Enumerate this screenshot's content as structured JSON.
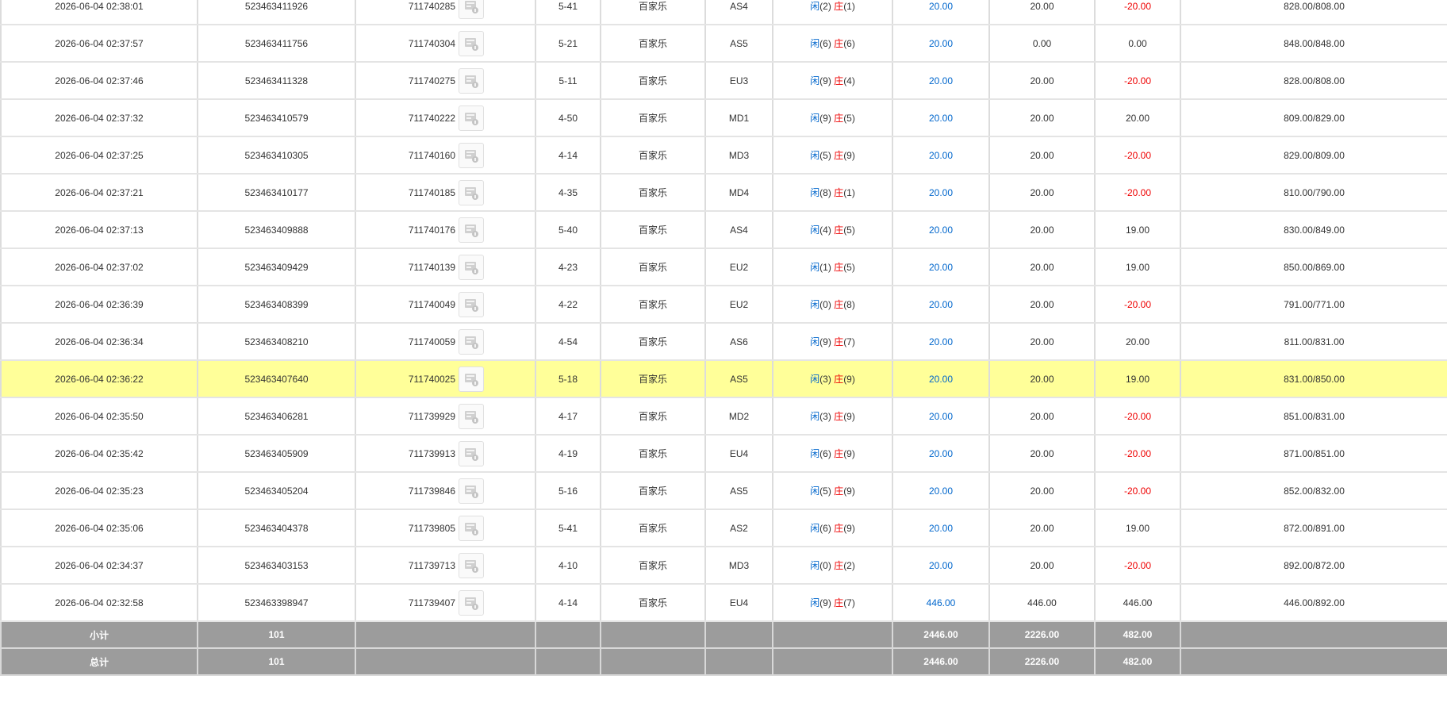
{
  "table": {
    "rows": [
      {
        "time": "2026-06-04 02:38:01",
        "order_id": "523463411926",
        "round": "711740285",
        "shoe": "5-41",
        "game": "百家乐",
        "table": "AS4",
        "p_label": "闲",
        "p_val": "(2)",
        "b_label": "庄",
        "b_val": "(1)",
        "bet": "20.00",
        "valid": "20.00",
        "result": "-20.00",
        "result_color": "red",
        "balance": "828.00/808.00"
      },
      {
        "time": "2026-06-04 02:37:57",
        "order_id": "523463411756",
        "round": "711740304",
        "shoe": "5-21",
        "game": "百家乐",
        "table": "AS5",
        "p_label": "闲",
        "p_val": "(6)",
        "b_label": "庄",
        "b_val": "(6)",
        "bet": "20.00",
        "valid": "0.00",
        "result": "0.00",
        "result_color": "dark",
        "balance": "848.00/848.00"
      },
      {
        "time": "2026-06-04 02:37:46",
        "order_id": "523463411328",
        "round": "711740275",
        "shoe": "5-11",
        "game": "百家乐",
        "table": "EU3",
        "p_label": "闲",
        "p_val": "(9)",
        "b_label": "庄",
        "b_val": "(4)",
        "bet": "20.00",
        "valid": "20.00",
        "result": "-20.00",
        "result_color": "red",
        "balance": "828.00/808.00"
      },
      {
        "time": "2026-06-04 02:37:32",
        "order_id": "523463410579",
        "round": "711740222",
        "shoe": "4-50",
        "game": "百家乐",
        "table": "MD1",
        "p_label": "闲",
        "p_val": "(9)",
        "b_label": "庄",
        "b_val": "(5)",
        "bet": "20.00",
        "valid": "20.00",
        "result": "20.00",
        "result_color": "dark",
        "balance": "809.00/829.00"
      },
      {
        "time": "2026-06-04 02:37:25",
        "order_id": "523463410305",
        "round": "711740160",
        "shoe": "4-14",
        "game": "百家乐",
        "table": "MD3",
        "p_label": "闲",
        "p_val": "(5)",
        "b_label": "庄",
        "b_val": "(9)",
        "bet": "20.00",
        "valid": "20.00",
        "result": "-20.00",
        "result_color": "red",
        "balance": "829.00/809.00"
      },
      {
        "time": "2026-06-04 02:37:21",
        "order_id": "523463410177",
        "round": "711740185",
        "shoe": "4-35",
        "game": "百家乐",
        "table": "MD4",
        "p_label": "闲",
        "p_val": "(8)",
        "b_label": "庄",
        "b_val": "(1)",
        "bet": "20.00",
        "valid": "20.00",
        "result": "-20.00",
        "result_color": "red",
        "balance": "810.00/790.00"
      },
      {
        "time": "2026-06-04 02:37:13",
        "order_id": "523463409888",
        "round": "711740176",
        "shoe": "5-40",
        "game": "百家乐",
        "table": "AS4",
        "p_label": "闲",
        "p_val": "(4)",
        "b_label": "庄",
        "b_val": "(5)",
        "bet": "20.00",
        "valid": "20.00",
        "result": "19.00",
        "result_color": "dark",
        "balance": "830.00/849.00"
      },
      {
        "time": "2026-06-04 02:37:02",
        "order_id": "523463409429",
        "round": "711740139",
        "shoe": "4-23",
        "game": "百家乐",
        "table": "EU2",
        "p_label": "闲",
        "p_val": "(1)",
        "b_label": "庄",
        "b_val": "(5)",
        "bet": "20.00",
        "valid": "20.00",
        "result": "19.00",
        "result_color": "dark",
        "balance": "850.00/869.00"
      },
      {
        "time": "2026-06-04 02:36:39",
        "order_id": "523463408399",
        "round": "711740049",
        "shoe": "4-22",
        "game": "百家乐",
        "table": "EU2",
        "p_label": "闲",
        "p_val": "(0)",
        "b_label": "庄",
        "b_val": "(8)",
        "bet": "20.00",
        "valid": "20.00",
        "result": "-20.00",
        "result_color": "red",
        "balance": "791.00/771.00"
      },
      {
        "time": "2026-06-04 02:36:34",
        "order_id": "523463408210",
        "round": "711740059",
        "shoe": "4-54",
        "game": "百家乐",
        "table": "AS6",
        "p_label": "闲",
        "p_val": "(9)",
        "b_label": "庄",
        "b_val": "(7)",
        "bet": "20.00",
        "valid": "20.00",
        "result": "20.00",
        "result_color": "dark",
        "balance": "811.00/831.00"
      },
      {
        "time": "2026-06-04 02:36:22",
        "order_id": "523463407640",
        "round": "711740025",
        "shoe": "5-18",
        "game": "百家乐",
        "table": "AS5",
        "p_label": "闲",
        "p_val": "(3)",
        "b_label": "庄",
        "b_val": "(9)",
        "bet": "20.00",
        "valid": "20.00",
        "result": "19.00",
        "result_color": "dark",
        "balance": "831.00/850.00",
        "highlight": true
      },
      {
        "time": "2026-06-04 02:35:50",
        "order_id": "523463406281",
        "round": "711739929",
        "shoe": "4-17",
        "game": "百家乐",
        "table": "MD2",
        "p_label": "闲",
        "p_val": "(3)",
        "b_label": "庄",
        "b_val": "(9)",
        "bet": "20.00",
        "valid": "20.00",
        "result": "-20.00",
        "result_color": "red",
        "balance": "851.00/831.00"
      },
      {
        "time": "2026-06-04 02:35:42",
        "order_id": "523463405909",
        "round": "711739913",
        "shoe": "4-19",
        "game": "百家乐",
        "table": "EU4",
        "p_label": "闲",
        "p_val": "(6)",
        "b_label": "庄",
        "b_val": "(9)",
        "bet": "20.00",
        "valid": "20.00",
        "result": "-20.00",
        "result_color": "red",
        "balance": "871.00/851.00"
      },
      {
        "time": "2026-06-04 02:35:23",
        "order_id": "523463405204",
        "round": "711739846",
        "shoe": "5-16",
        "game": "百家乐",
        "table": "AS5",
        "p_label": "闲",
        "p_val": "(5)",
        "b_label": "庄",
        "b_val": "(9)",
        "bet": "20.00",
        "valid": "20.00",
        "result": "-20.00",
        "result_color": "red",
        "balance": "852.00/832.00"
      },
      {
        "time": "2026-06-04 02:35:06",
        "order_id": "523463404378",
        "round": "711739805",
        "shoe": "5-41",
        "game": "百家乐",
        "table": "AS2",
        "p_label": "闲",
        "p_val": "(6)",
        "b_label": "庄",
        "b_val": "(9)",
        "bet": "20.00",
        "valid": "20.00",
        "result": "19.00",
        "result_color": "dark",
        "balance": "872.00/891.00"
      },
      {
        "time": "2026-06-04 02:34:37",
        "order_id": "523463403153",
        "round": "711739713",
        "shoe": "4-10",
        "game": "百家乐",
        "table": "MD3",
        "p_label": "闲",
        "p_val": "(0)",
        "b_label": "庄",
        "b_val": "(2)",
        "bet": "20.00",
        "valid": "20.00",
        "result": "-20.00",
        "result_color": "red",
        "balance": "892.00/872.00"
      },
      {
        "time": "2026-06-04 02:32:58",
        "order_id": "523463398947",
        "round": "711739407",
        "shoe": "4-14",
        "game": "百家乐",
        "table": "EU4",
        "p_label": "闲",
        "p_val": "(9)",
        "b_label": "庄",
        "b_val": "(7)",
        "bet": "446.00",
        "valid": "446.00",
        "result": "446.00",
        "result_color": "dark",
        "balance": "446.00/892.00"
      }
    ],
    "summary": [
      {
        "label": "小计",
        "count": "101",
        "bet": "2446.00",
        "valid": "2226.00",
        "result": "482.00"
      },
      {
        "label": "总计",
        "count": "101",
        "bet": "2446.00",
        "valid": "2226.00",
        "result": "482.00"
      }
    ]
  },
  "icons": {
    "detail": "bet-detail-icon"
  },
  "colors": {
    "highlight_row": "#ffff99",
    "summary_bg": "#9c9c9c",
    "player_blue": "#0066cc",
    "banker_red": "#ee0000",
    "loss_red": "#ee0000"
  }
}
